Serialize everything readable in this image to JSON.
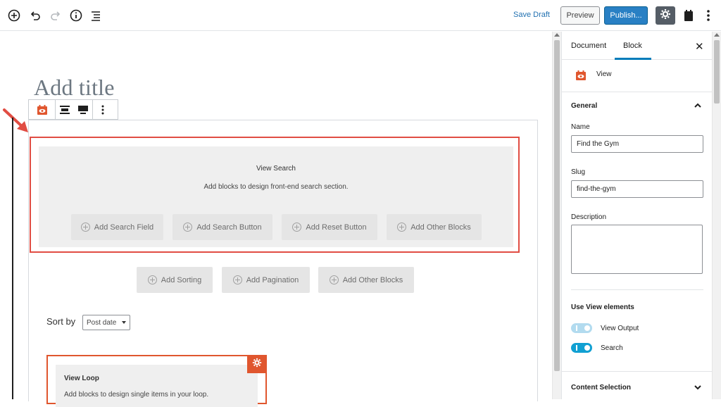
{
  "topbar": {
    "icons": [
      "add-block-icon",
      "undo-icon",
      "redo-icon",
      "info-icon",
      "block-navigation-icon"
    ],
    "save_draft": "Save Draft",
    "preview": "Preview",
    "publish": "Publish...",
    "settings_icon": "gear-icon",
    "plugin_icon": "toolset-icon",
    "more_icon": "more-vertical-icon"
  },
  "editor": {
    "title_placeholder": "Add title",
    "block_toolbar": {
      "icons": [
        "view-block-icon",
        "align-wide-icon",
        "align-full-icon",
        "more-options-icon"
      ]
    },
    "view_search": {
      "title": "View Search",
      "subtitle": "Add blocks to design front-end search section.",
      "buttons": [
        "Add Search Field",
        "Add Search Button",
        "Add Reset Button",
        "Add Other Blocks"
      ]
    },
    "view_buttons": [
      "Add Sorting",
      "Add Pagination",
      "Add Other Blocks"
    ],
    "sort": {
      "label": "Sort by",
      "selected": "Post date"
    },
    "view_loop": {
      "title": "View Loop",
      "subtitle": "Add blocks to design single items in your loop."
    }
  },
  "sidebar": {
    "tabs": [
      "Document",
      "Block"
    ],
    "active_tab": "Block",
    "block_name": "View",
    "general": {
      "heading": "General",
      "name_label": "Name",
      "name_value": "Find the Gym",
      "slug_label": "Slug",
      "slug_value": "find-the-gym",
      "description_label": "Description",
      "description_value": ""
    },
    "view_elements": {
      "heading": "Use View elements",
      "toggles": [
        {
          "label": "View Output",
          "enabled": true,
          "disabled_style": true
        },
        {
          "label": "Search",
          "enabled": true,
          "disabled_style": false
        }
      ]
    },
    "content_selection": "Content Selection"
  },
  "colors": {
    "accent": "#007cba",
    "publish": "#2980c4",
    "highlight_red": "#e14d43",
    "toolset_orange": "#e0562e"
  }
}
